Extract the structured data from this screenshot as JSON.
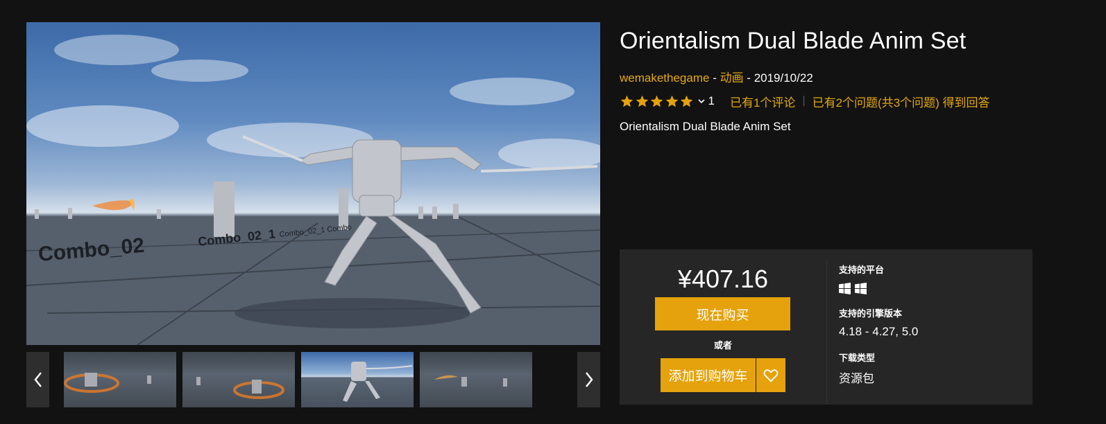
{
  "product": {
    "title": "Orientalism Dual Blade Anim Set",
    "author": "wemakethegame",
    "category": "动画",
    "date": "2019/10/22",
    "meta_separator": " - ",
    "rating_stars": 5,
    "rating_count": "1",
    "reviews_link": "已有1个评论",
    "qa_link": "已有2个问题(共3个问题) 得到回答",
    "subtitle": "Orientalism Dual Blade Anim Set"
  },
  "gallery": {
    "prev_icon": "chevron-left-icon",
    "next_icon": "chevron-right-icon",
    "main_labels": [
      "Combo_02",
      "Combo_02_1",
      "Combo_02_1 Combo"
    ],
    "thumbnails": [
      {
        "active": false
      },
      {
        "active": false
      },
      {
        "active": true
      },
      {
        "active": false
      }
    ]
  },
  "purchase": {
    "price": "¥407.16",
    "buy_label": "现在购买",
    "or_label": "或者",
    "cart_label": "添加到购物车",
    "wishlist_icon": "heart-icon"
  },
  "specs": {
    "platform_label": "支持的平台",
    "platform_icons": [
      "windows-icon",
      "windows-icon"
    ],
    "engine_label": "支持的引擎版本",
    "engine_value": "4.18 - 4.27, 5.0",
    "download_label": "下载类型",
    "download_value": "资源包"
  },
  "colors": {
    "accent": "#e5a20c",
    "link": "#e5a90f",
    "background": "#121212",
    "panel": "#262626"
  }
}
